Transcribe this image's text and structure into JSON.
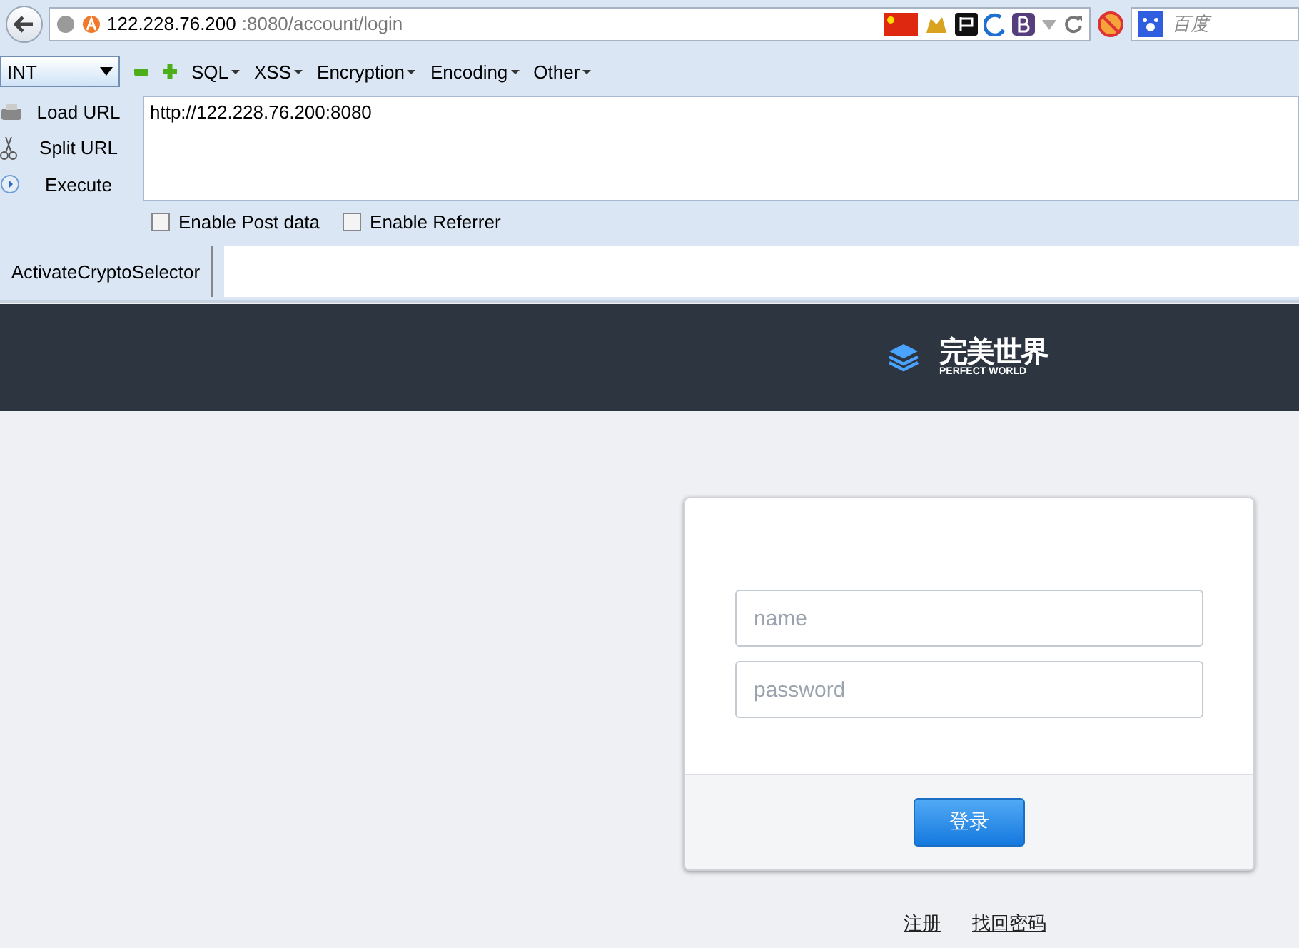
{
  "address_bar": {
    "url_host": "122.228.76.200",
    "url_path": ":8080/account/login",
    "search_placeholder": "百度"
  },
  "hackbar": {
    "dropdown": "INT",
    "menus": [
      "SQL",
      "XSS",
      "Encryption",
      "Encoding",
      "Other"
    ],
    "actions": [
      "Load URL",
      "Split URL",
      "Execute"
    ],
    "url_value": "http://122.228.76.200:8080",
    "options": [
      {
        "label": "Enable Post data",
        "checked": false
      },
      {
        "label": "Enable Referrer",
        "checked": false
      }
    ],
    "crypto_label": "ActivateCryptoSelector"
  },
  "site": {
    "logo_cn": "完美世界",
    "logo_en": "PERFECT WORLD"
  },
  "login": {
    "fields": [
      {
        "placeholder": "name"
      },
      {
        "placeholder": "password"
      }
    ],
    "submit": "登录",
    "links": [
      "注册",
      "找回密码"
    ]
  }
}
